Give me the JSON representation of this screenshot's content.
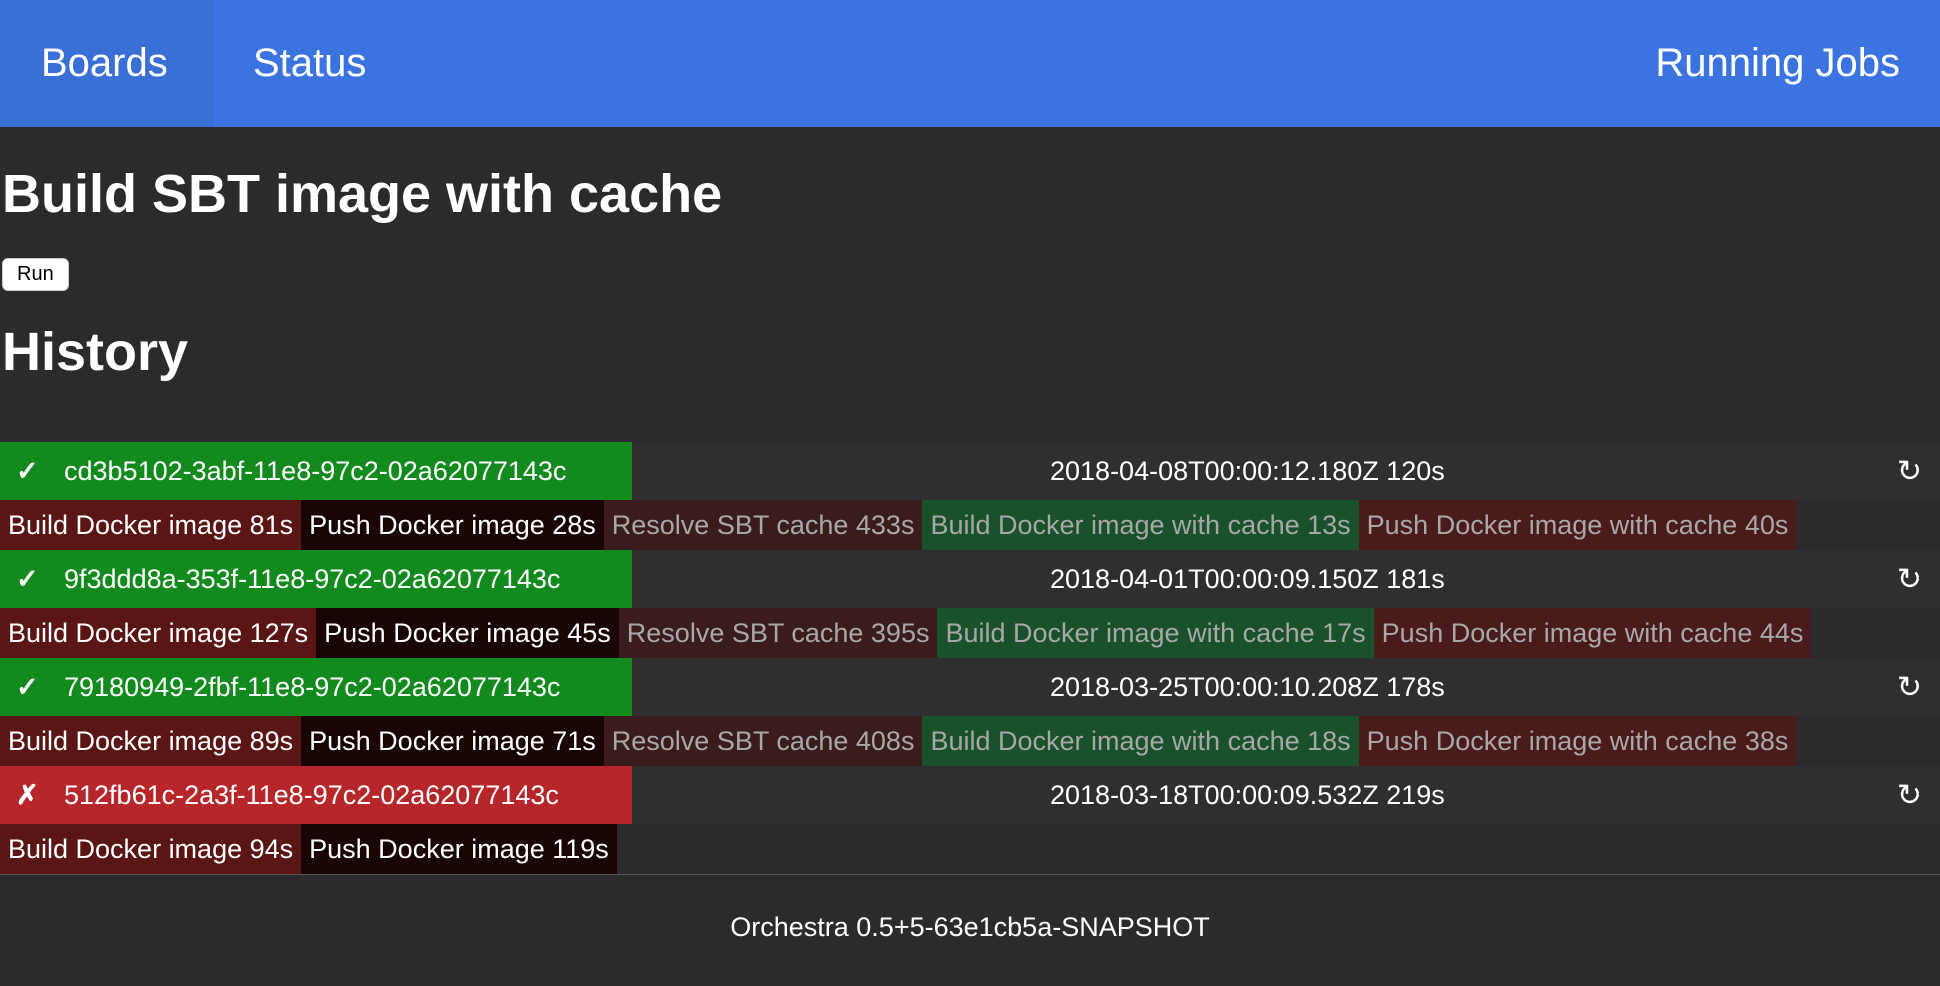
{
  "nav": {
    "boards": "Boards",
    "status": "Status",
    "running_jobs": "Running Jobs"
  },
  "page": {
    "title": "Build SBT image with cache",
    "run_button": "Run",
    "history_title": "History"
  },
  "colors": {
    "topbar": "#3b74e0",
    "background": "#2b2b2b",
    "success": "#138a1e",
    "failure": "#b6262a"
  },
  "history": [
    {
      "status": "success",
      "status_icon": "✓",
      "id": "cd3b5102-3abf-11e8-97c2-02a62077143c",
      "date": "2018-04-08T00:00:12.180Z 120s",
      "rerun_icon": "↻",
      "steps": [
        "Build Docker image 81s",
        "Push Docker image 28s",
        "Resolve SBT cache 433s",
        "Build Docker image with cache 13s",
        "Push Docker image with cache 40s"
      ]
    },
    {
      "status": "success",
      "status_icon": "✓",
      "id": "9f3ddd8a-353f-11e8-97c2-02a62077143c",
      "date": "2018-04-01T00:00:09.150Z 181s",
      "rerun_icon": "↻",
      "steps": [
        "Build Docker image 127s",
        "Push Docker image 45s",
        "Resolve SBT cache 395s",
        "Build Docker image with cache 17s",
        "Push Docker image with cache 44s"
      ]
    },
    {
      "status": "success",
      "status_icon": "✓",
      "id": "79180949-2fbf-11e8-97c2-02a62077143c",
      "date": "2018-03-25T00:00:10.208Z 178s",
      "rerun_icon": "↻",
      "steps": [
        "Build Docker image 89s",
        "Push Docker image 71s",
        "Resolve SBT cache 408s",
        "Build Docker image with cache 18s",
        "Push Docker image with cache 38s"
      ]
    },
    {
      "status": "failure",
      "status_icon": "✗",
      "id": "512fb61c-2a3f-11e8-97c2-02a62077143c",
      "date": "2018-03-18T00:00:09.532Z 219s",
      "rerun_icon": "↻",
      "steps": [
        "Build Docker image 94s",
        "Push Docker image 119s"
      ]
    }
  ],
  "footer": {
    "version": "Orchestra 0.5+5-63e1cb5a-SNAPSHOT"
  }
}
